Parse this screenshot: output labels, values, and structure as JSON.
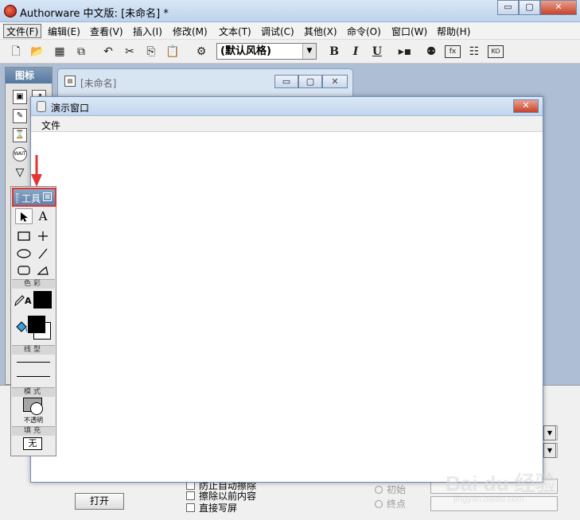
{
  "app": {
    "title": "Authorware 中文版: [未命名] *",
    "min": "▭",
    "max": "▢",
    "close": "✕"
  },
  "menubar": {
    "items": [
      "文件(F)",
      "编辑(E)",
      "查看(V)",
      "插入(I)",
      "修改(M)",
      "文本(T)",
      "调试(C)",
      "其他(X)",
      "命令(O)",
      "窗口(W)",
      "帮助(H)"
    ]
  },
  "toolbar": {
    "style_select_value": "(默认风格)",
    "bold": "B",
    "italic": "I",
    "underline": "U"
  },
  "icon_palette": {
    "title": "图标"
  },
  "design_window": {
    "title": "[未命名]"
  },
  "presentation_window": {
    "title": "演示窗口",
    "menu_file": "文件"
  },
  "tools_palette": {
    "title": "工具",
    "close": "⊠",
    "section_color": "色彩",
    "section_line": "线型",
    "section_mode": "模式",
    "mode_value": "不透明",
    "section_fill": "填充",
    "fill_value": "无",
    "text_tool": "A",
    "pencil_label": "A"
  },
  "property_panel": {
    "open_button": "打开",
    "checkbox_1": "防止自动擦除",
    "checkbox_2": "擦除以前内容",
    "checkbox_3": "直接写屏",
    "radio_1": "初始",
    "radio_2": "终点"
  },
  "watermark": {
    "text": "Bai du 经验",
    "sub": "jingyan.baidu.com"
  },
  "colors": {
    "annotation_red": "#e23535",
    "title_blue": "#c2d6ee",
    "close_red": "#c7432b"
  }
}
